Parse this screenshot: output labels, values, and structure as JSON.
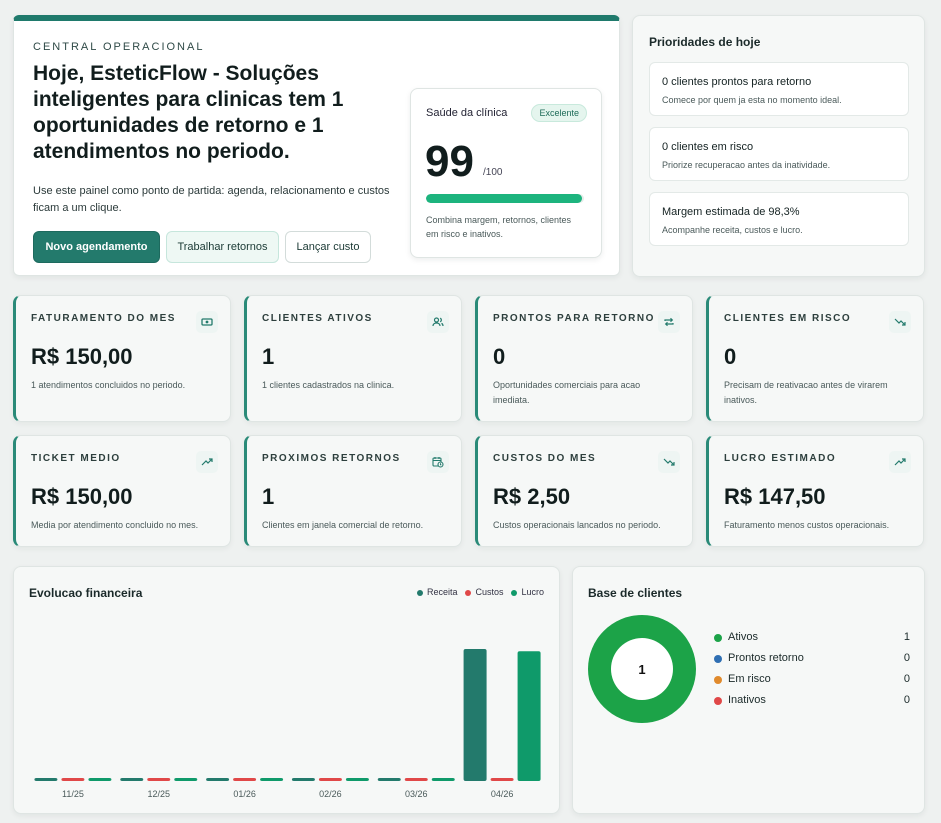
{
  "hero": {
    "eyebrow": "CENTRAL OPERACIONAL",
    "title": "Hoje, EsteticFlow - Soluções inteligentes para clinicas tem 1 oportunidades de retorno e 1 atendimentos no periodo.",
    "description": "Use este painel como ponto de partida: agenda, relacionamento e custos ficam a um clique.",
    "buttons": {
      "primary": "Novo agendamento",
      "secondary": "Trabalhar retornos",
      "tertiary": "Lançar custo"
    },
    "health": {
      "label": "Saúde da clínica",
      "badge": "Excelente",
      "score": "99",
      "max": "/100",
      "progress_percent": 99,
      "note": "Combina margem, retornos, clientes em risco e inativos."
    }
  },
  "priorities": {
    "title": "Prioridades de hoje",
    "items": [
      {
        "title": "0 clientes prontos para retorno",
        "subtitle": "Comece por quem ja esta no momento ideal."
      },
      {
        "title": "0 clientes em risco",
        "subtitle": "Priorize recuperacao antes da inatividade."
      },
      {
        "title": "Margem estimada de 98,3%",
        "subtitle": "Acompanhe receita, custos e lucro."
      }
    ]
  },
  "kpis": [
    {
      "label": "FATURAMENTO DO MES",
      "icon": "cash-icon",
      "value": "R$ 150,00",
      "sub": "1 atendimentos concluidos no periodo."
    },
    {
      "label": "CLIENTES ATIVOS",
      "icon": "users-icon",
      "value": "1",
      "sub": "1 clientes cadastrados na clinica."
    },
    {
      "label": "PRONTOS PARA RETORNO",
      "icon": "repeat-icon",
      "value": "0",
      "sub": "Oportunidades comerciais para acao imediata."
    },
    {
      "label": "CLIENTES EM RISCO",
      "icon": "trend-down-icon",
      "value": "0",
      "sub": "Precisam de reativacao antes de virarem inativos."
    },
    {
      "label": "TICKET MEDIO",
      "icon": "trend-up-icon",
      "value": "R$ 150,00",
      "sub": "Media por atendimento concluido no mes."
    },
    {
      "label": "PROXIMOS RETORNOS",
      "icon": "calendar-clock-icon",
      "value": "1",
      "sub": "Clientes em janela comercial de retorno."
    },
    {
      "label": "CUSTOS DO MES",
      "icon": "trend-down-icon",
      "value": "R$ 2,50",
      "sub": "Custos operacionais lancados no periodo."
    },
    {
      "label": "LUCRO ESTIMADO",
      "icon": "trend-up-icon",
      "value": "R$ 147,50",
      "sub": "Faturamento menos custos operacionais."
    }
  ],
  "chart_data": {
    "type": "bar",
    "title": "Evolucao financeira",
    "categories": [
      "11/25",
      "12/25",
      "01/26",
      "02/26",
      "03/26",
      "04/26"
    ],
    "series": [
      {
        "name": "Receita",
        "color": "#237a6c",
        "values": [
          0,
          0,
          0,
          0,
          0,
          150
        ]
      },
      {
        "name": "Custos",
        "color": "#e04848",
        "values": [
          0,
          0,
          0,
          0,
          0,
          2.5
        ]
      },
      {
        "name": "Lucro",
        "color": "#0f9a6a",
        "values": [
          0,
          0,
          0,
          0,
          0,
          147.5
        ]
      }
    ],
    "ylim": [
      0,
      150
    ],
    "grid": false,
    "legend_position": "top-right"
  },
  "clients": {
    "title": "Base de clientes",
    "total": "1",
    "items": [
      {
        "name": "Ativos",
        "count": "1",
        "color": "#1ca348"
      },
      {
        "name": "Prontos retorno",
        "count": "0",
        "color": "#2f6fb3"
      },
      {
        "name": "Em risco",
        "count": "0",
        "color": "#e08a2c"
      },
      {
        "name": "Inativos",
        "count": "0",
        "color": "#e04848"
      }
    ]
  }
}
